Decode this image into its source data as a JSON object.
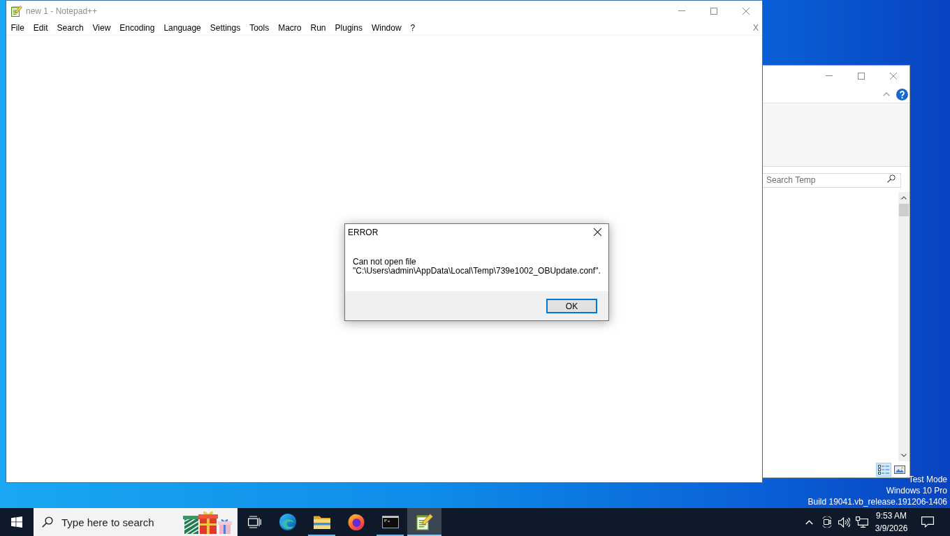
{
  "notepad": {
    "title": "new 1 - Notepad++",
    "menu": [
      "File",
      "Edit",
      "Search",
      "View",
      "Encoding",
      "Language",
      "Settings",
      "Tools",
      "Macro",
      "Run",
      "Plugins",
      "Window",
      "?"
    ],
    "close_document": "X"
  },
  "explorer": {
    "search": {
      "placeholder": "Search Temp"
    },
    "views": [
      {
        "kind": "details",
        "selected": true
      },
      {
        "kind": "large_icons",
        "selected": false
      }
    ]
  },
  "dialog": {
    "title": "ERROR",
    "message": "Can not open file\n\"C:\\Users\\admin\\AppData\\Local\\Temp\\739e1002_OBUpdate.conf\".",
    "buttons": [
      {
        "label": "OK",
        "default": true
      }
    ]
  },
  "desktop": {
    "lines": [
      "Test Mode",
      "Windows 10 Pro",
      "Build 19041.vb_release.191206-1406"
    ]
  },
  "taskbar": {
    "search": {
      "placeholder": "Type here to search"
    },
    "apps": [
      {
        "kind": "edge",
        "running": false,
        "selected": false
      },
      {
        "kind": "explorer",
        "running": true,
        "selected": false
      },
      {
        "kind": "firefox",
        "running": false,
        "selected": false
      },
      {
        "kind": "terminal",
        "running": true,
        "selected": false
      },
      {
        "kind": "notepad",
        "running": true,
        "selected": true
      }
    ],
    "clock": {
      "time": "9:53 AM",
      "date": "3/9/2026"
    }
  }
}
